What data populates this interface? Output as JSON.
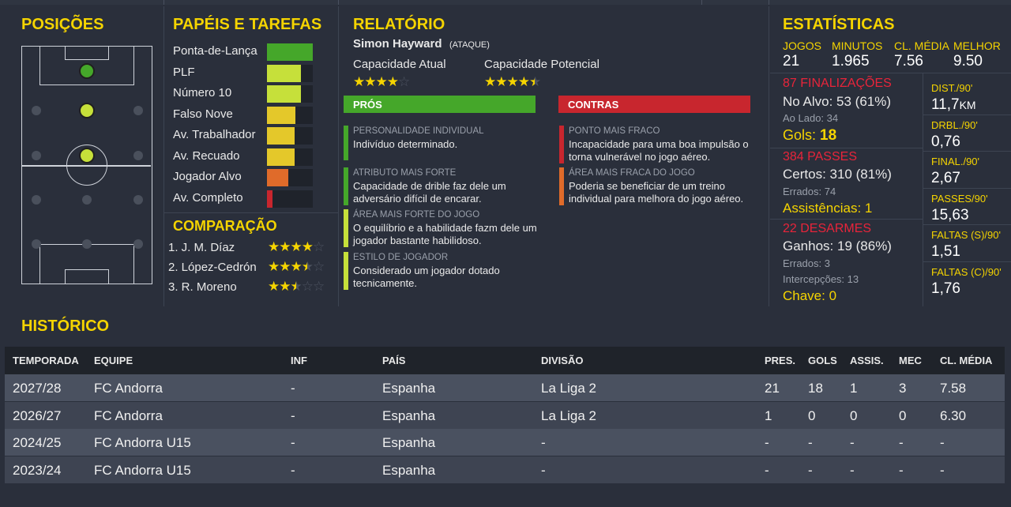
{
  "positions": {
    "title": "POSIÇÕES"
  },
  "roles": {
    "title": "PAPÉIS E TAREFAS",
    "items": [
      {
        "label": "Ponta-de-Lança",
        "value": 1.0,
        "color": "#45a72a"
      },
      {
        "label": "PLF",
        "value": 0.74,
        "color": "#c6e03a"
      },
      {
        "label": "Número 10",
        "value": 0.74,
        "color": "#c6e03a"
      },
      {
        "label": "Falso Nove",
        "value": 0.62,
        "color": "#e4c82a"
      },
      {
        "label": "Av. Trabalhador",
        "value": 0.6,
        "color": "#e4c82a"
      },
      {
        "label": "Av. Recuado",
        "value": 0.6,
        "color": "#e4c82a"
      },
      {
        "label": "Jogador Alvo",
        "value": 0.47,
        "color": "#e06b2a"
      },
      {
        "label": "Av. Completo",
        "value": 0.12,
        "color": "#c8262e"
      }
    ]
  },
  "comparison": {
    "title": "COMPARAÇÃO",
    "items": [
      {
        "label": "1. J. M. Díaz",
        "stars": 4
      },
      {
        "label": "2. López-Cedrón",
        "stars": 3.5
      },
      {
        "label": "3. R. Moreno",
        "stars": 2.5
      }
    ]
  },
  "report": {
    "title": "RELATÓRIO",
    "player_name": "Simon Hayward",
    "player_role": "(ATAQUE)",
    "current_ability_label": "Capacidade Atual",
    "current_ability_stars": 4,
    "potential_ability_label": "Capacidade Potencial",
    "potential_ability_stars": 4.5,
    "pros_label": "PRÓS",
    "cons_label": "CONTRAS",
    "pros": [
      {
        "title": "PERSONALIDADE INDIVIDUAL",
        "text": "Indivíduo determinado.",
        "color": "#45a72a"
      },
      {
        "title": "ATRIBUTO MAIS FORTE",
        "text": "Capacidade de drible faz dele um adversário difícil de encarar.",
        "color": "#45a72a"
      },
      {
        "title": "ÁREA MAIS FORTE DO JOGO",
        "text": "O equilíbrio e a habilidade fazm dele um jogador bastante habilidoso.",
        "color": "#c6e03a"
      },
      {
        "title": "ESTILO DE JOGADOR",
        "text": "Considerado um jogador dotado tecnicamente.",
        "color": "#c6e03a"
      }
    ],
    "cons": [
      {
        "title": "PONTO MAIS FRACO",
        "text": "Incapacidade para uma boa impulsão o torna vulnerável no jogo aéreo.",
        "color": "#c8262e"
      },
      {
        "title": "ÁREA MAIS FRACA DO JOGO",
        "text": "Poderia se beneficiar de um treino individual para melhora do jogo aéreo.",
        "color": "#e06b2a"
      }
    ]
  },
  "stats": {
    "title": "ESTATÍSTICAS",
    "summary": [
      {
        "label": "JOGOS",
        "value": "21"
      },
      {
        "label": "MINUTOS",
        "value": "1.965"
      },
      {
        "label": "CL. MÉDIA",
        "value": "7.56"
      },
      {
        "label": "MELHOR",
        "value": "9.50"
      }
    ],
    "shots_title": "87 FINALIZAÇÕES",
    "on_target": "No Alvo: 53 (61%)",
    "off_target": "Ao Lado: 34",
    "goals_label": "Gols:",
    "goals_value": "18",
    "passes_title": "384 PASSES",
    "passes_completed": "Certos: 310 (81%)",
    "passes_missed": "Errados: 74",
    "assists": "Assistências: 1",
    "tackles_title": "22 DESARMES",
    "tackles_won": "Ganhos: 19 (86%)",
    "tackles_lost": "Errados: 3",
    "interceptions": "Intercepções: 13",
    "key": "Chave: 0",
    "per90": [
      {
        "label": "DIST./90'",
        "value": "11,7",
        "unit": "KM"
      },
      {
        "label": "DRBL./90'",
        "value": "0,76",
        "unit": ""
      },
      {
        "label": "FINAL./90'",
        "value": "2,67",
        "unit": ""
      },
      {
        "label": "PASSES/90'",
        "value": "15,63",
        "unit": ""
      },
      {
        "label": "FALTAS (S)/90'",
        "value": "1,51",
        "unit": ""
      },
      {
        "label": "FALTAS (C)/90'",
        "value": "1,76",
        "unit": ""
      }
    ]
  },
  "history": {
    "title": "HISTÓRICO",
    "columns": [
      "TEMPORADA",
      "EQUIPE",
      "INF",
      "PAÍS",
      "DIVISÃO",
      "PRES.",
      "GOLS",
      "ASSIS.",
      "MEC",
      "CL. MÉDIA"
    ],
    "rows": [
      [
        "2027/28",
        "FC Andorra",
        "-",
        "Espanha",
        "La Liga 2",
        "21",
        "18",
        "1",
        "3",
        "7.58"
      ],
      [
        "2026/27",
        "FC Andorra",
        "-",
        "Espanha",
        "La Liga 2",
        "1",
        "0",
        "0",
        "0",
        "6.30"
      ],
      [
        "2024/25",
        "FC Andorra U15",
        "-",
        "Espanha",
        "-",
        "-",
        "-",
        "-",
        "-",
        "-"
      ],
      [
        "2023/24",
        "FC Andorra U15",
        "-",
        "Espanha",
        "-",
        "-",
        "-",
        "-",
        "-",
        "-"
      ]
    ]
  },
  "colors": {
    "accent": "#f5d400",
    "red": "#e8243a",
    "pros": "#45a72a",
    "cons": "#c8262e"
  }
}
